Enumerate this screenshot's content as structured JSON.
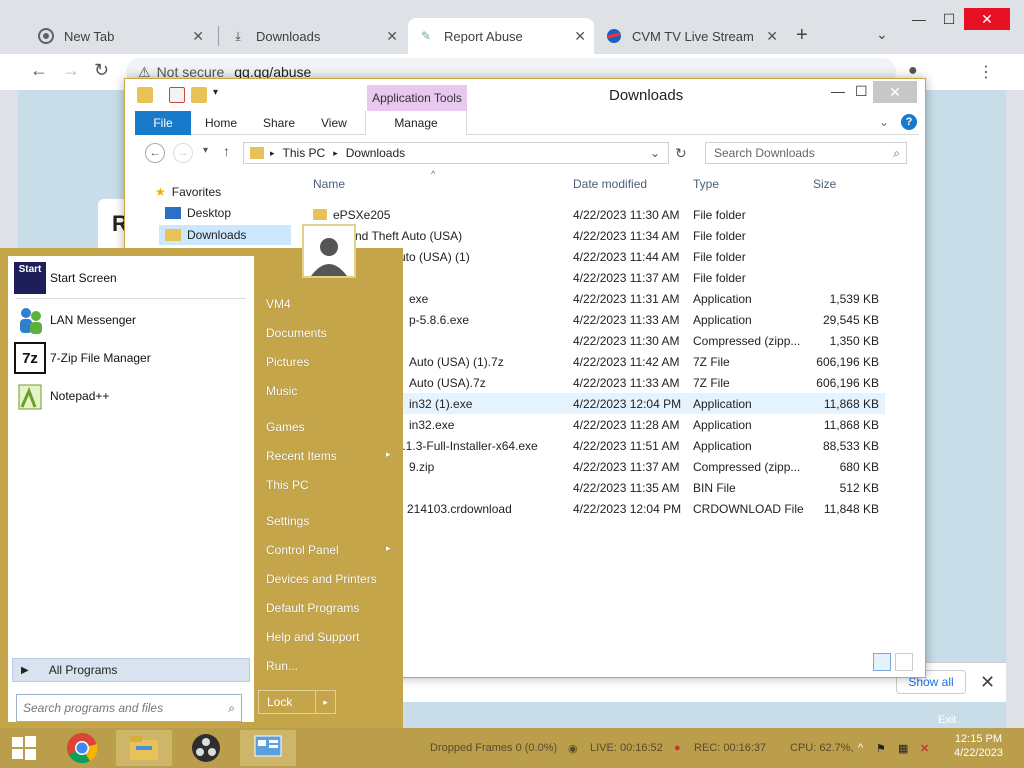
{
  "browser": {
    "tabs": [
      {
        "title": "New Tab",
        "icon": "chrome-icon"
      },
      {
        "title": "Downloads",
        "icon": "download-icon"
      },
      {
        "title": "Report Abuse",
        "icon": "puzzle-icon"
      },
      {
        "title": "CVM TV Live Stream On",
        "icon": "cvm-logo-icon"
      }
    ],
    "url_security": "Not secure",
    "url": "qq.qq/abuse",
    "page_letter": "R",
    "show_all": "Show all"
  },
  "explorer": {
    "title": "Downloads",
    "app_tools": "Application Tools",
    "ribbon_tabs": [
      "File",
      "Home",
      "Share",
      "View"
    ],
    "manage": "Manage",
    "breadcrumb": [
      "This PC",
      "Downloads"
    ],
    "search_placeholder": "Search Downloads",
    "nav": {
      "favorites": "Favorites",
      "desktop": "Desktop",
      "downloads": "Downloads"
    },
    "columns": {
      "name": "Name",
      "date": "Date modified",
      "type": "Type",
      "size": "Size"
    },
    "files": [
      {
        "name": "ePSXe205",
        "date": "4/22/2023 11:30 AM",
        "type": "File folder",
        "size": ""
      },
      {
        "name": "nd Theft Auto (USA)",
        "date": "4/22/2023 11:34 AM",
        "type": "File folder",
        "size": ""
      },
      {
        "name": "Auto (USA) (1)",
        "date": "4/22/2023 11:44 AM",
        "type": "File folder",
        "size": ""
      },
      {
        "name": "9",
        "date": "4/22/2023 11:37 AM",
        "type": "File folder",
        "size": ""
      },
      {
        "name": "exe",
        "date": "4/22/2023 11:31 AM",
        "type": "Application",
        "size": "1,539 KB"
      },
      {
        "name": "p-5.8.6.exe",
        "date": "4/22/2023 11:33 AM",
        "type": "Application",
        "size": "29,545 KB"
      },
      {
        "name": "",
        "date": "4/22/2023 11:30 AM",
        "type": "Compressed (zipp...",
        "size": "1,350 KB"
      },
      {
        "name": "Auto (USA) (1).7z",
        "date": "4/22/2023 11:42 AM",
        "type": "7Z File",
        "size": "606,196 KB"
      },
      {
        "name": "Auto (USA).7z",
        "date": "4/22/2023 11:33 AM",
        "type": "7Z File",
        "size": "606,196 KB"
      },
      {
        "name": "in32 (1).exe",
        "date": "4/22/2023 12:04 PM",
        "type": "Application",
        "size": "11,868 KB"
      },
      {
        "name": "in32.exe",
        "date": "4/22/2023 11:28 AM",
        "type": "Application",
        "size": "11,868 KB"
      },
      {
        "name": "27.1.3-Full-Installer-x64.exe",
        "date": "4/22/2023 11:51 AM",
        "type": "Application",
        "size": "88,533 KB"
      },
      {
        "name": "9.zip",
        "date": "4/22/2023 11:37 AM",
        "type": "Compressed (zipp...",
        "size": "680 KB"
      },
      {
        "name": "",
        "date": "4/22/2023 11:35 AM",
        "type": "BIN File",
        "size": "512 KB"
      },
      {
        "name": "214103.crdownload",
        "date": "4/22/2023 12:04 PM",
        "type": "CRDOWNLOAD File",
        "size": "11,848 KB"
      }
    ]
  },
  "startmenu": {
    "pinned": [
      {
        "label": "Start Screen",
        "icon": "start-screen-icon"
      },
      {
        "label": "LAN Messenger",
        "icon": "lan-messenger-icon"
      },
      {
        "label": "7-Zip File Manager",
        "icon": "7zip-icon"
      },
      {
        "label": "Notepad++",
        "icon": "notepadpp-icon"
      }
    ],
    "start_icon_text": "Start",
    "sevenzip_icon_text": "7z",
    "all_programs": "All Programs",
    "search_placeholder": "Search programs and files",
    "right": [
      "VM4",
      "Documents",
      "Pictures",
      "Music",
      "Games",
      "Recent Items",
      "This PC",
      "Settings",
      "Control Panel",
      "Devices and Printers",
      "Default Programs",
      "Help and Support",
      "Run..."
    ],
    "lock": "Lock"
  },
  "taskbar": {
    "apps": [
      "start-button",
      "chrome-icon",
      "file-explorer-icon",
      "obs-icon",
      "control-panel-icon"
    ],
    "obs_status": {
      "dropped": "Dropped Frames 0 (0.0%)",
      "live": "LIVE: 00:16:52",
      "rec": "REC: 00:16:37",
      "cpu": "CPU: 62.7%,"
    },
    "time": "12:15 PM",
    "date": "4/22/2023",
    "exit": "Exit"
  }
}
